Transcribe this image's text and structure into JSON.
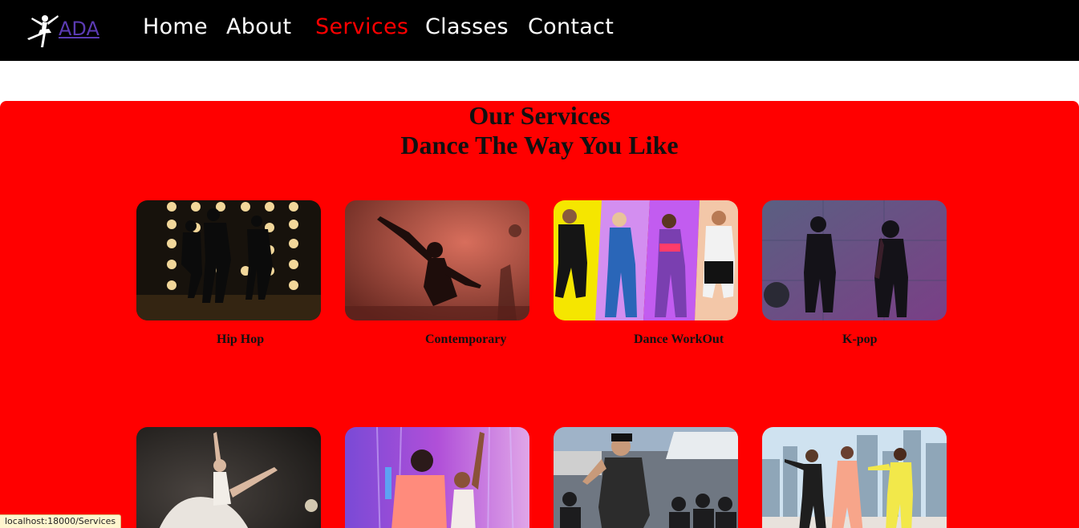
{
  "navbar": {
    "brand": "ADA",
    "links": [
      {
        "label": "Home",
        "active": false
      },
      {
        "label": "About",
        "active": false
      },
      {
        "label": "Services",
        "active": true
      },
      {
        "label": "Classes",
        "active": false
      },
      {
        "label": "Contact",
        "active": false
      }
    ]
  },
  "services": {
    "title": "Our Services",
    "subtitle": "Dance The Way You Like",
    "cards": [
      {
        "label": "Hip Hop",
        "icon": "hip-hop-photo"
      },
      {
        "label": "Contemporary",
        "icon": "contemporary-photo"
      },
      {
        "label": "Dance WorkOut",
        "icon": "dance-workout-photo"
      },
      {
        "label": "K-pop",
        "icon": "kpop-photo"
      },
      {
        "label": "",
        "icon": "ballet-photo"
      },
      {
        "label": "",
        "icon": "salsa-photo"
      },
      {
        "label": "",
        "icon": "street-dance-photo"
      },
      {
        "label": "",
        "icon": "rooftop-dance-photo"
      }
    ]
  },
  "status_bar": {
    "url": "localhost:18000/Services"
  },
  "colors": {
    "navbar": "#000000",
    "section": "#ff0000",
    "active_link": "#ff0000",
    "brand_link": "#5b3bb3"
  }
}
